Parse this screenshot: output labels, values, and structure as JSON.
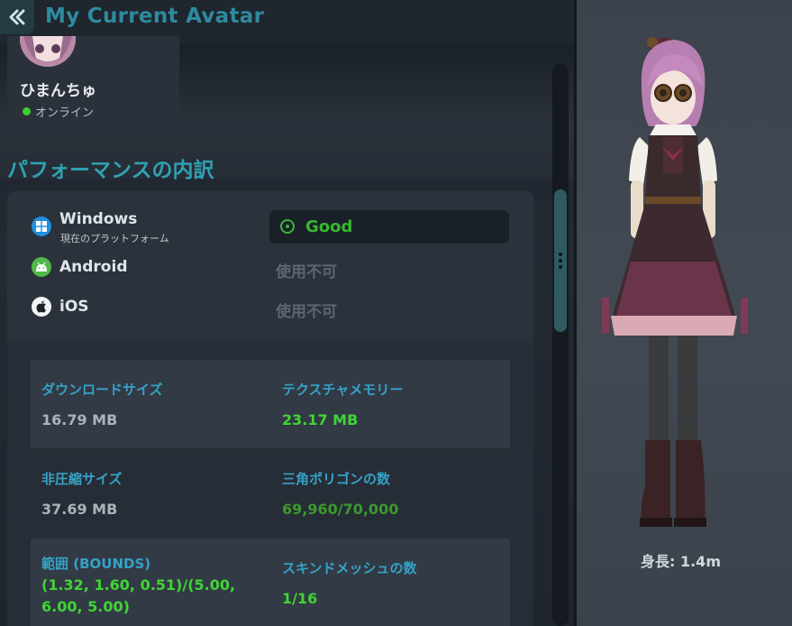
{
  "header": {
    "back_icon": "double-chevron-left-icon",
    "title": "My Current Avatar"
  },
  "user": {
    "name": "ひまんちゅ",
    "status": "オンライン",
    "status_color": "#3ecf2c"
  },
  "performance": {
    "section_title": "パフォーマンスの内訳",
    "platforms": [
      {
        "icon": "windows-icon",
        "name": "Windows",
        "subtitle": "現在のプラットフォーム",
        "rating": "Good",
        "rating_color": "#37b92e"
      },
      {
        "icon": "android-icon",
        "name": "Android",
        "rating": "使用不可"
      },
      {
        "icon": "apple-icon",
        "name": "iOS",
        "rating": "使用不可"
      }
    ],
    "stats": [
      {
        "label": "ダウンロードサイズ",
        "value": "16.79 MB"
      },
      {
        "label": "テクスチャメモリー",
        "value": "23.17 MB"
      },
      {
        "label": "非圧縮サイズ",
        "value": "37.69 MB"
      },
      {
        "label": "三角ポリゴンの数",
        "value": "69,960/70,000"
      },
      {
        "label": "範囲 (BOUNDS)",
        "value_line1": "(1.32, 1.60, 0.51)/(5.00,",
        "value_line2": "6.00, 5.00)"
      },
      {
        "label": "スキンドメッシュの数",
        "value": "1/16"
      }
    ]
  },
  "preview": {
    "height_label": "身長: 1.4m"
  },
  "colors": {
    "accent": "#2fa2b2",
    "label_blue": "#36a2c7",
    "good_green": "#40d534"
  }
}
